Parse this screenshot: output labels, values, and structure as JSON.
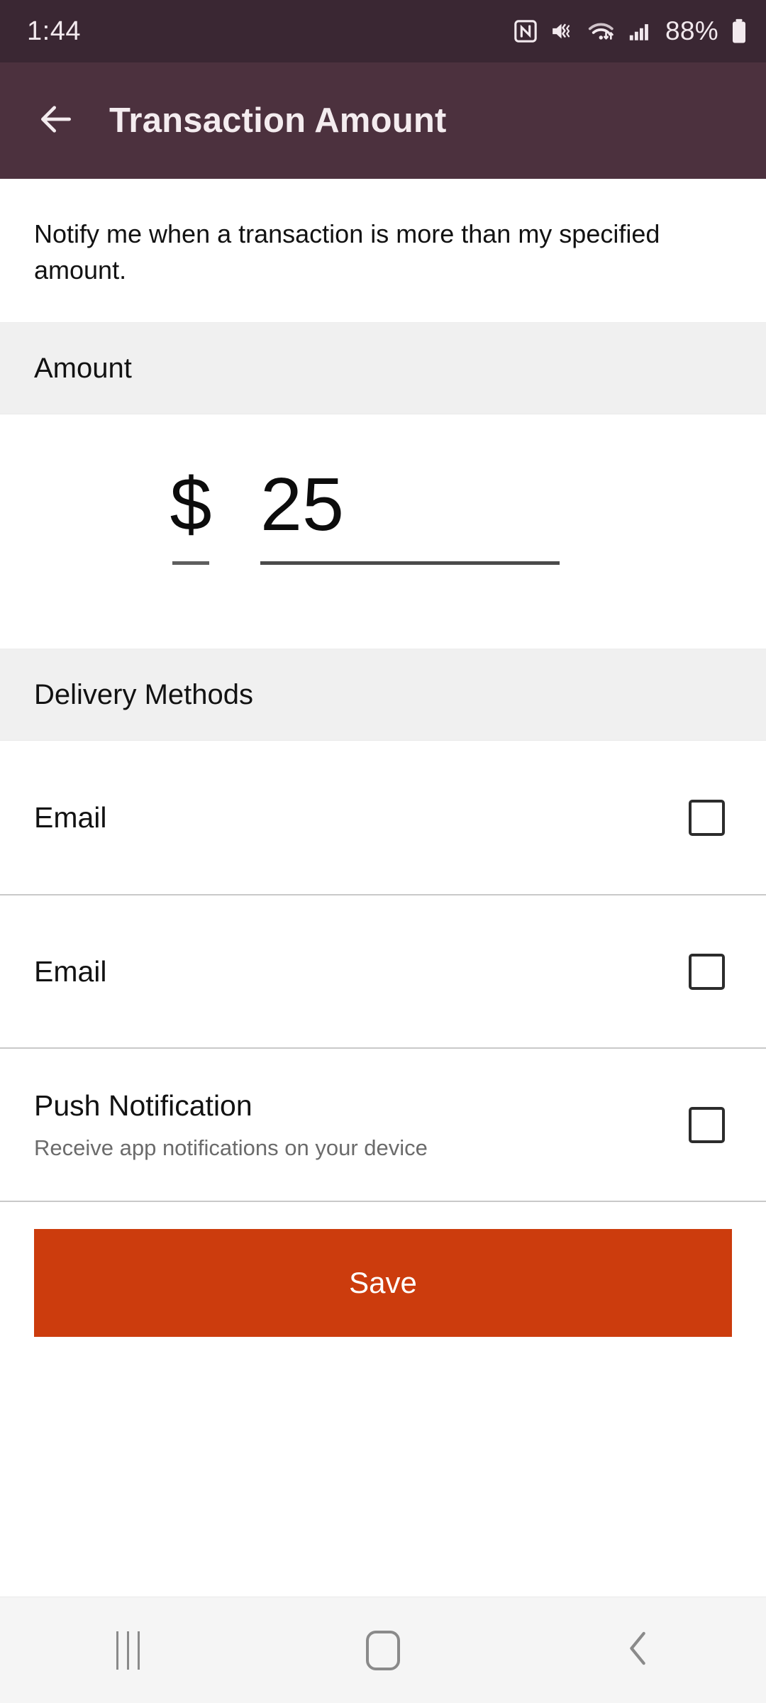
{
  "status_bar": {
    "time": "1:44",
    "battery_percent": "88%",
    "icons": [
      "nfc-icon",
      "sound-mute-vibrate-icon",
      "wifi-icon",
      "cellular-signal-icon",
      "battery-icon"
    ]
  },
  "app_bar": {
    "back_label": "back-arrow-icon",
    "title": "Transaction Amount",
    "background_color": "#4C313E"
  },
  "intro": {
    "text": "Notify me when a transaction is more than my specified amount."
  },
  "amount_section": {
    "header": "Amount",
    "currency_symbol": "$",
    "value": "25"
  },
  "delivery_section": {
    "header": "Delivery Methods",
    "methods": [
      {
        "title": "Email",
        "subtitle": "",
        "checked": false
      },
      {
        "title": "Email",
        "subtitle": "",
        "checked": false
      },
      {
        "title": "Push Notification",
        "subtitle": "Receive app notifications on your device",
        "checked": false
      }
    ]
  },
  "actions": {
    "save_label": "Save",
    "save_color": "#CC3C0D"
  },
  "nav_bar": {
    "recents_label": "recents-icon",
    "home_label": "home-icon",
    "back_label": "back-chevron-icon"
  }
}
